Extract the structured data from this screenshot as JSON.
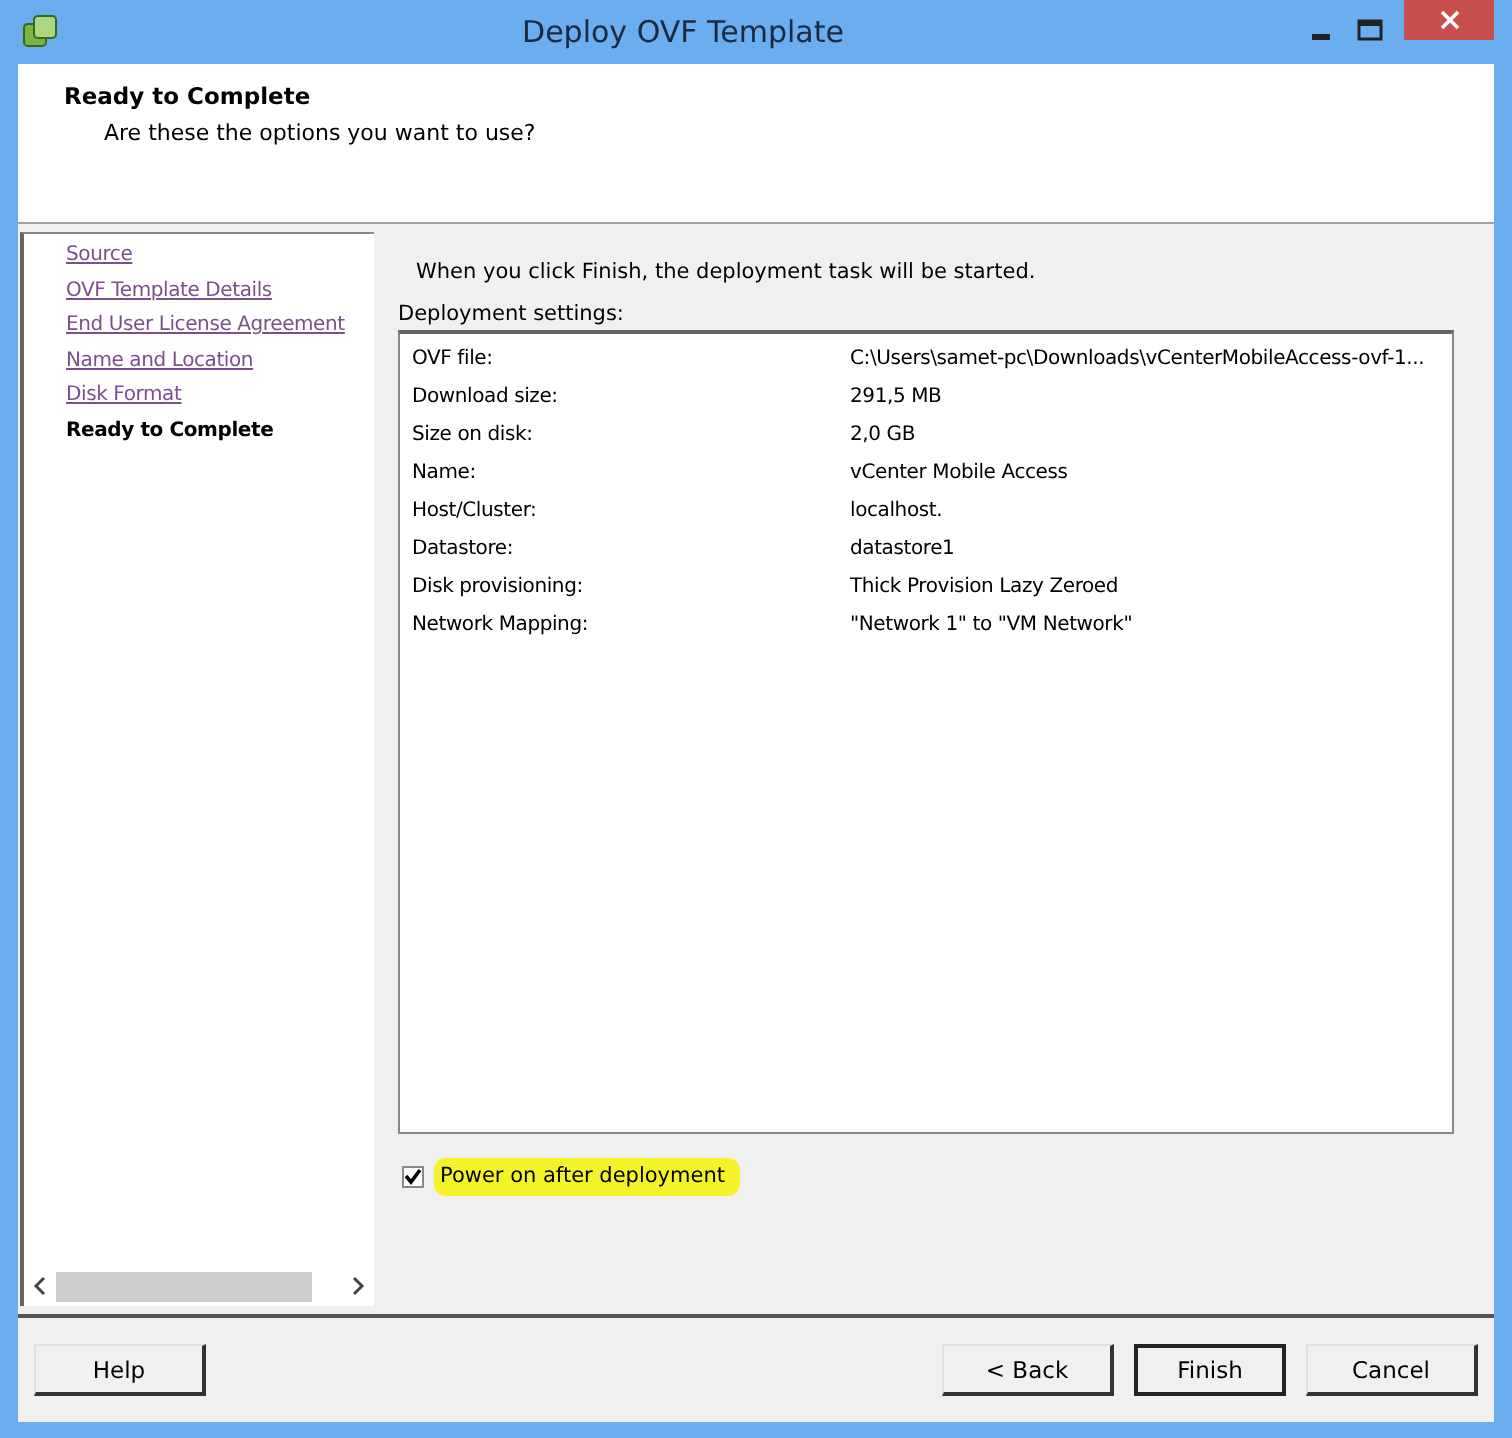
{
  "window": {
    "title": "Deploy OVF Template"
  },
  "header": {
    "title": "Ready to Complete",
    "subtitle": "Are these the options you want to use?"
  },
  "steps": [
    {
      "label": "Source",
      "selected": false
    },
    {
      "label": "OVF Template Details",
      "selected": false
    },
    {
      "label": "End User License Agreement",
      "selected": false
    },
    {
      "label": "Name and Location",
      "selected": false
    },
    {
      "label": "Disk Format",
      "selected": false
    },
    {
      "label": "Ready to Complete",
      "selected": true
    }
  ],
  "intro": "When you click Finish, the deployment task will be started.",
  "settings_label": "Deployment settings:",
  "settings": [
    {
      "name": "OVF file:",
      "value": "C:\\Users\\samet-pc\\Downloads\\vCenterMobileAccess-ovf-1..."
    },
    {
      "name": "Download size:",
      "value": "291,5 MB"
    },
    {
      "name": "Size on disk:",
      "value": "2,0 GB"
    },
    {
      "name": "Name:",
      "value": "vCenter Mobile Access"
    },
    {
      "name": "Host/Cluster:",
      "value": "localhost."
    },
    {
      "name": "Datastore:",
      "value": "datastore1"
    },
    {
      "name": "Disk provisioning:",
      "value": "Thick Provision Lazy Zeroed"
    },
    {
      "name": "Network Mapping:",
      "value": "\"Network 1\" to \"VM Network\""
    }
  ],
  "power_on": {
    "label": "Power on after deployment",
    "checked": true,
    "highlighted": true
  },
  "buttons": [
    {
      "label": "Help",
      "kind": "left"
    },
    {
      "label": "< Back",
      "kind": "right"
    },
    {
      "label": "Finish",
      "kind": "default"
    },
    {
      "label": "Cancel",
      "kind": "right"
    }
  ]
}
